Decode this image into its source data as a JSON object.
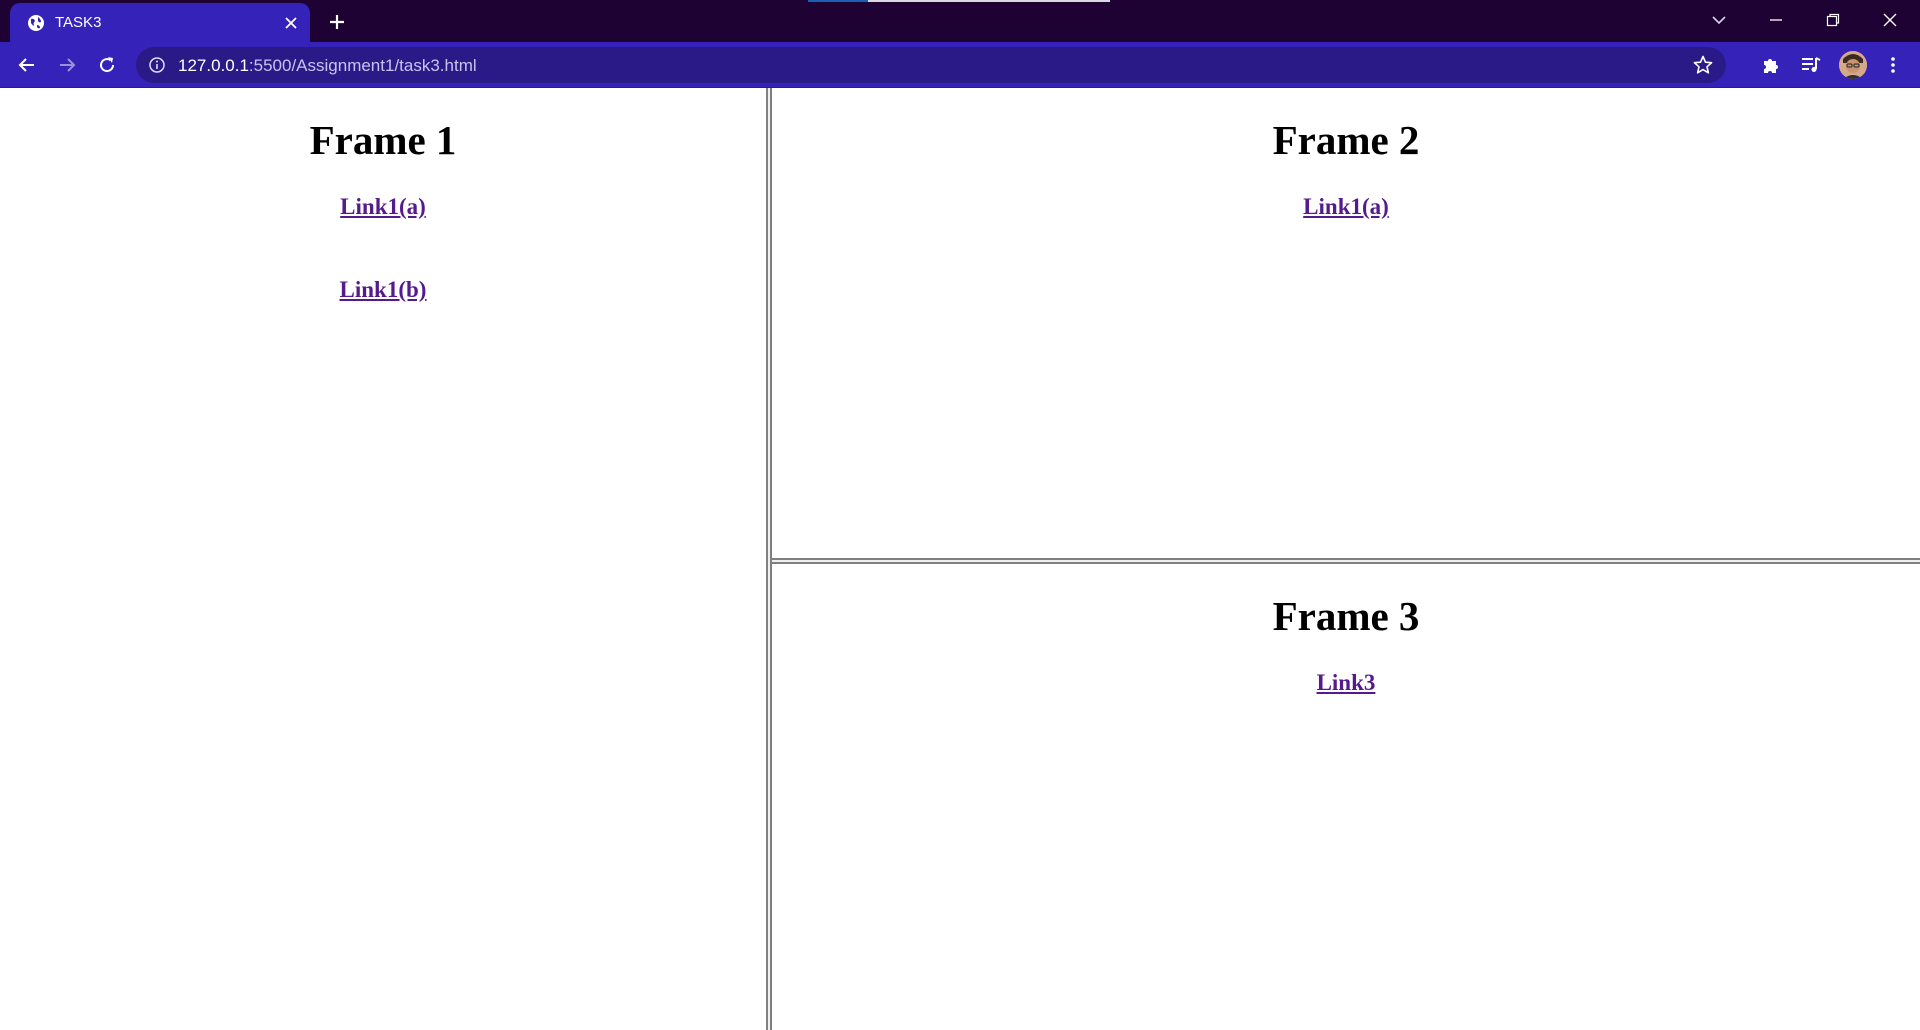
{
  "browser": {
    "tab_title": "TASK3",
    "url_host": "127.0.0.1",
    "url_path": ":5500/Assignment1/task3.html"
  },
  "frames": {
    "frame1": {
      "heading": "Frame 1",
      "links": [
        "Link1(a)",
        "Link1(b)"
      ]
    },
    "frame2": {
      "heading": "Frame 2",
      "links": [
        "Link1(a)"
      ]
    },
    "frame3": {
      "heading": "Frame 3",
      "links": [
        "Link3"
      ]
    }
  },
  "colors": {
    "titlebar": "#1e0233",
    "toolbar": "#3522b8",
    "omnibox": "#2a1a88",
    "visited_link": "#551a8b"
  },
  "icons": {
    "favicon": "globe-icon",
    "close_tab": "close-icon",
    "new_tab": "plus-icon",
    "back": "arrow-left-icon",
    "forward": "arrow-right-icon",
    "reload": "reload-icon",
    "site_info": "info-icon",
    "bookmark": "star-icon",
    "extensions": "puzzle-icon",
    "media": "media-queue-icon",
    "menu": "kebab-menu-icon"
  }
}
